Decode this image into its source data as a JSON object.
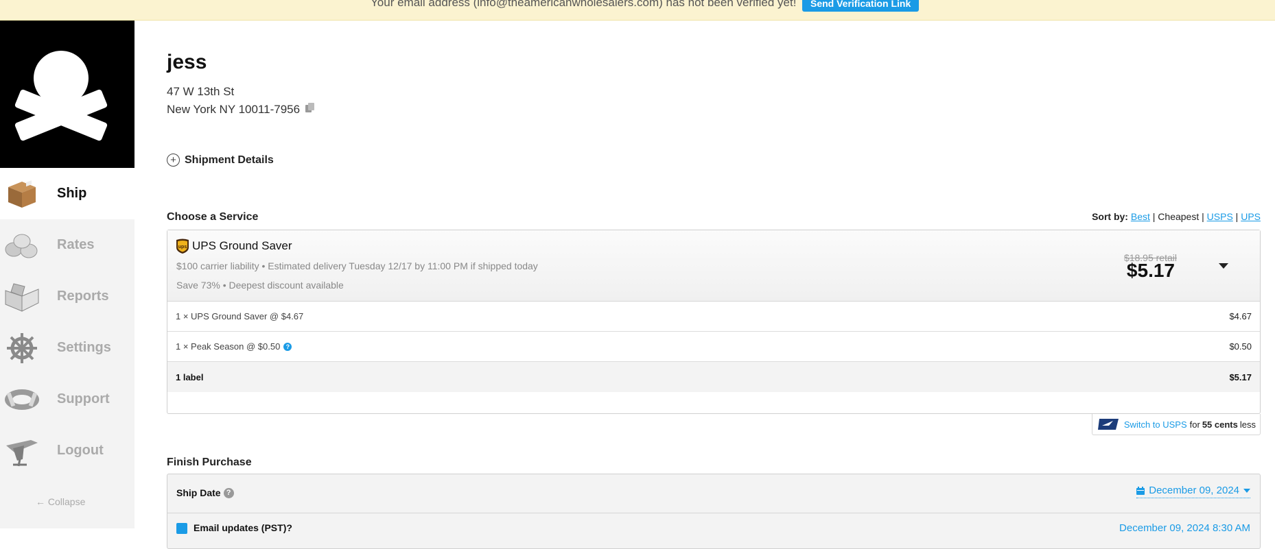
{
  "banner": {
    "message": "Your email address (info@theamericanwholesalers.com) has not been verified yet!",
    "button_label": "Send Verification Link"
  },
  "sidebar": {
    "items": [
      {
        "label": "Ship",
        "icon": "box-icon",
        "active": true
      },
      {
        "label": "Rates",
        "icon": "coins-icon",
        "active": false
      },
      {
        "label": "Reports",
        "icon": "book-icon",
        "active": false
      },
      {
        "label": "Settings",
        "icon": "ship-wheel-icon",
        "active": false
      },
      {
        "label": "Support",
        "icon": "life-ring-icon",
        "active": false
      },
      {
        "label": "Logout",
        "icon": "plane-icon",
        "active": false
      }
    ],
    "collapse_label": "Collapse"
  },
  "recipient": {
    "name": "jess",
    "address_line1": "47 W 13th St",
    "address_line2": "New York NY 10011-7956"
  },
  "shipment_details_label": "Shipment Details",
  "choose_service": {
    "title": "Choose a Service",
    "sort_by_label": "Sort by:",
    "sort_options": [
      "Best",
      "Cheapest",
      "USPS",
      "UPS"
    ],
    "sort_separator": "|",
    "selected": {
      "name": "UPS Ground Saver",
      "line1": "$100 carrier liability • Estimated delivery Tuesday 12/17 by 11:00 PM if shipped today",
      "line2": "Save 73% • Deepest discount available",
      "retail": "$18.95 retail",
      "price": "$5.17"
    },
    "rows": [
      {
        "label": "1 × UPS Ground Saver @ $4.67",
        "amount": "$4.67"
      },
      {
        "label": "1 × Peak Season @ $0.50",
        "amount": "$0.50",
        "help": "?"
      },
      {
        "label": "1 label",
        "amount": "$5.17"
      }
    ],
    "switch": {
      "link": "Switch to USPS",
      "for": "for",
      "amount": "55 cents",
      "less": "less"
    }
  },
  "finish": {
    "title": "Finish Purchase",
    "ship_date_label": "Ship Date",
    "help": "?",
    "ship_date_value": "December 09, 2024",
    "row2_label": "Email updates (PST)?",
    "row2_value": "December 09, 2024 8:30 AM"
  },
  "colors": {
    "accent": "#1a9be6",
    "banner_bg": "#fbf3d0",
    "sidebar_bg": "#f3f3f3"
  }
}
